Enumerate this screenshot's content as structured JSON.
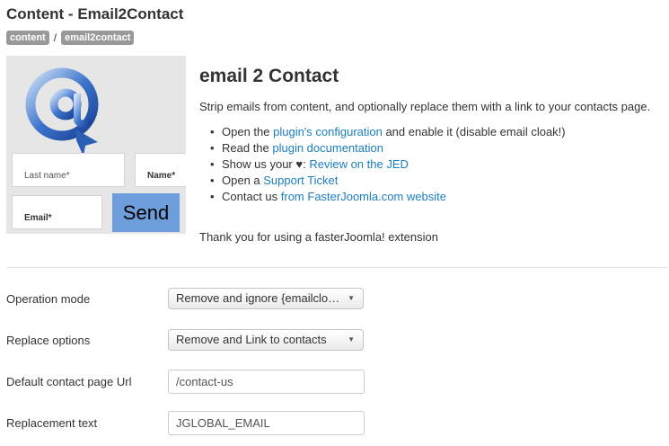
{
  "header": {
    "title": "Content - Email2Contact",
    "tags": [
      "content",
      "email2contact"
    ],
    "separator": "/"
  },
  "preview": {
    "last_name_placeholder": "Last name*",
    "name_placeholder": "Name*",
    "email_placeholder": "Email*",
    "send_label": "Send"
  },
  "info": {
    "heading": "email 2 Contact",
    "description": "Strip emails from content, and optionally replace them with a link to your contacts page.",
    "items": [
      {
        "pre": "Open the ",
        "link": "plugin's configuration",
        "post": " and enable it (disable email cloak!)"
      },
      {
        "pre": "Read the ",
        "link": "plugin documentation",
        "post": ""
      },
      {
        "pre": "Show us your ♥: ",
        "link": "Review on the JED",
        "post": ""
      },
      {
        "pre": "Open a ",
        "link": "Support Ticket",
        "post": ""
      },
      {
        "pre": "Contact us ",
        "link": "from FasterJoomla.com website",
        "post": ""
      }
    ],
    "thanks": "Thank you for using a fasterJoomla! extension"
  },
  "form": {
    "operation_mode": {
      "label": "Operation mode",
      "value": "Remove and ignore {emailclo…"
    },
    "replace_options": {
      "label": "Replace options",
      "value": "Remove and Link to contacts"
    },
    "contact_url": {
      "label": "Default contact page Url",
      "value": "/contact-us"
    },
    "replacement_text": {
      "label": "Replacement text",
      "value": "JGLOBAL_EMAIL"
    }
  },
  "colors": {
    "link": "#1a7fc1",
    "tag_bg": "#999999",
    "send_bg": "#6d9ddb",
    "preview_bg": "#e6e6e6"
  },
  "icons": {
    "bullet": "•",
    "caret": "▼",
    "logo": "at-sign-icon"
  }
}
